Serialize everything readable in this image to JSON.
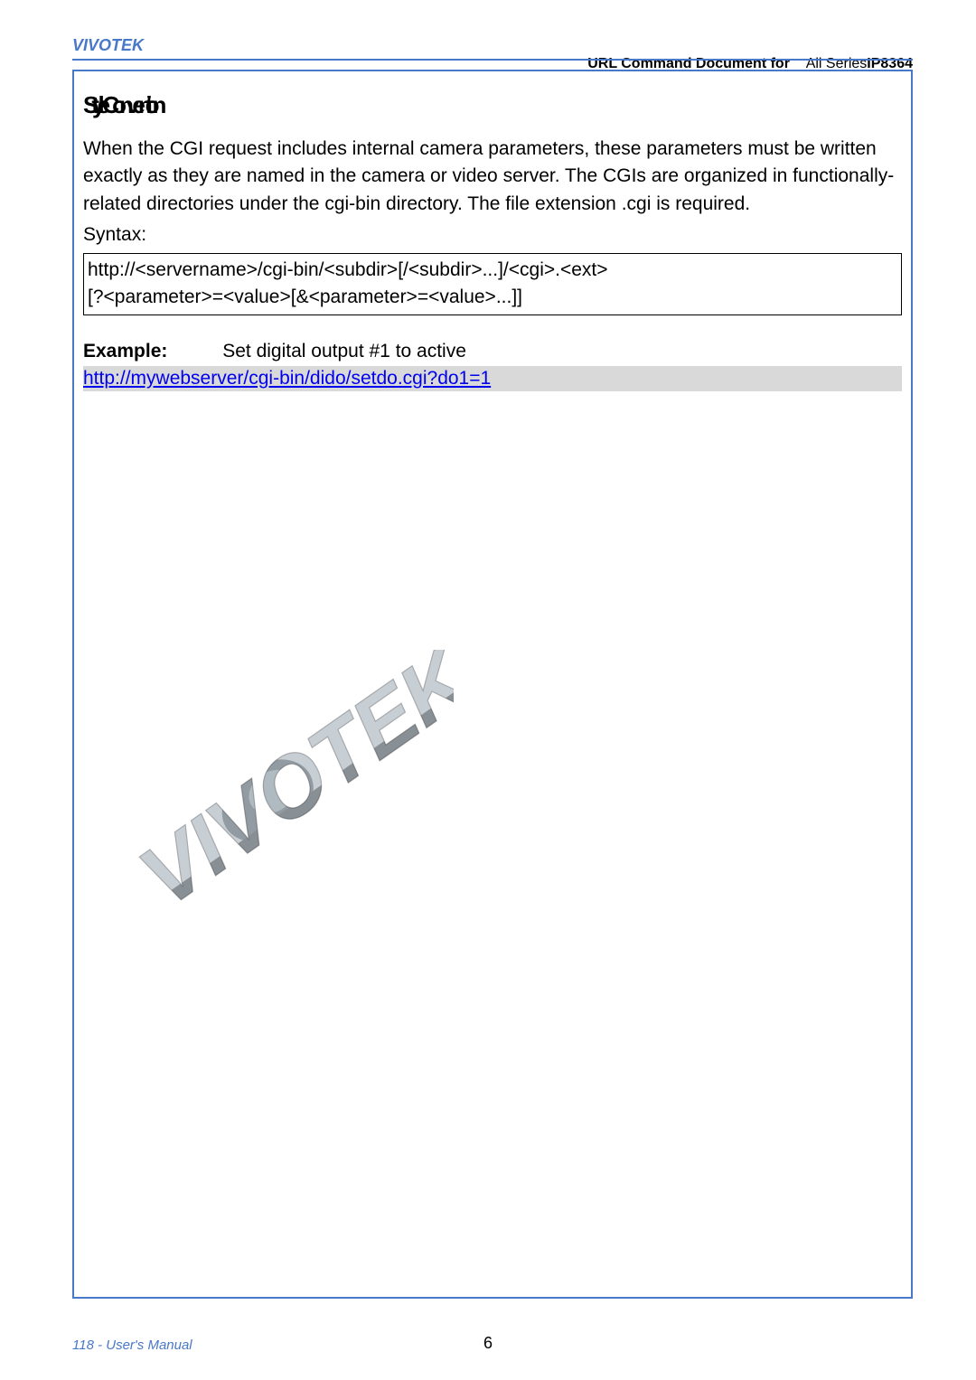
{
  "header": {
    "brand": "VIVOTEK",
    "doc_title_prefix": "URL Command Document for",
    "doc_title_suffix": "All Series",
    "model": "IP8364"
  },
  "section": {
    "heading": "Style Convention",
    "para1": "When the CGI request includes internal camera parameters, these parameters must be written exactly as they are named in the camera or video server. The CGIs are organized in functionally-related directories under the cgi-bin directory. The file extension .cgi is required.",
    "syntax_label": "Syntax:",
    "syntax_line1": "http://<servername>/cgi-bin/<subdir>[/<subdir>...]/<cgi>.<ext>",
    "syntax_line2": "[?<parameter>=<value>[&<parameter>=<value>...]]",
    "example_label": "Example:",
    "example_text": "Set digital output #1 to active",
    "example_url": "http://mywebserver/cgi-bin/dido/setdo.cgi?do1=1"
  },
  "footer": {
    "left": "118 - User's Manual",
    "page_num": "6"
  }
}
